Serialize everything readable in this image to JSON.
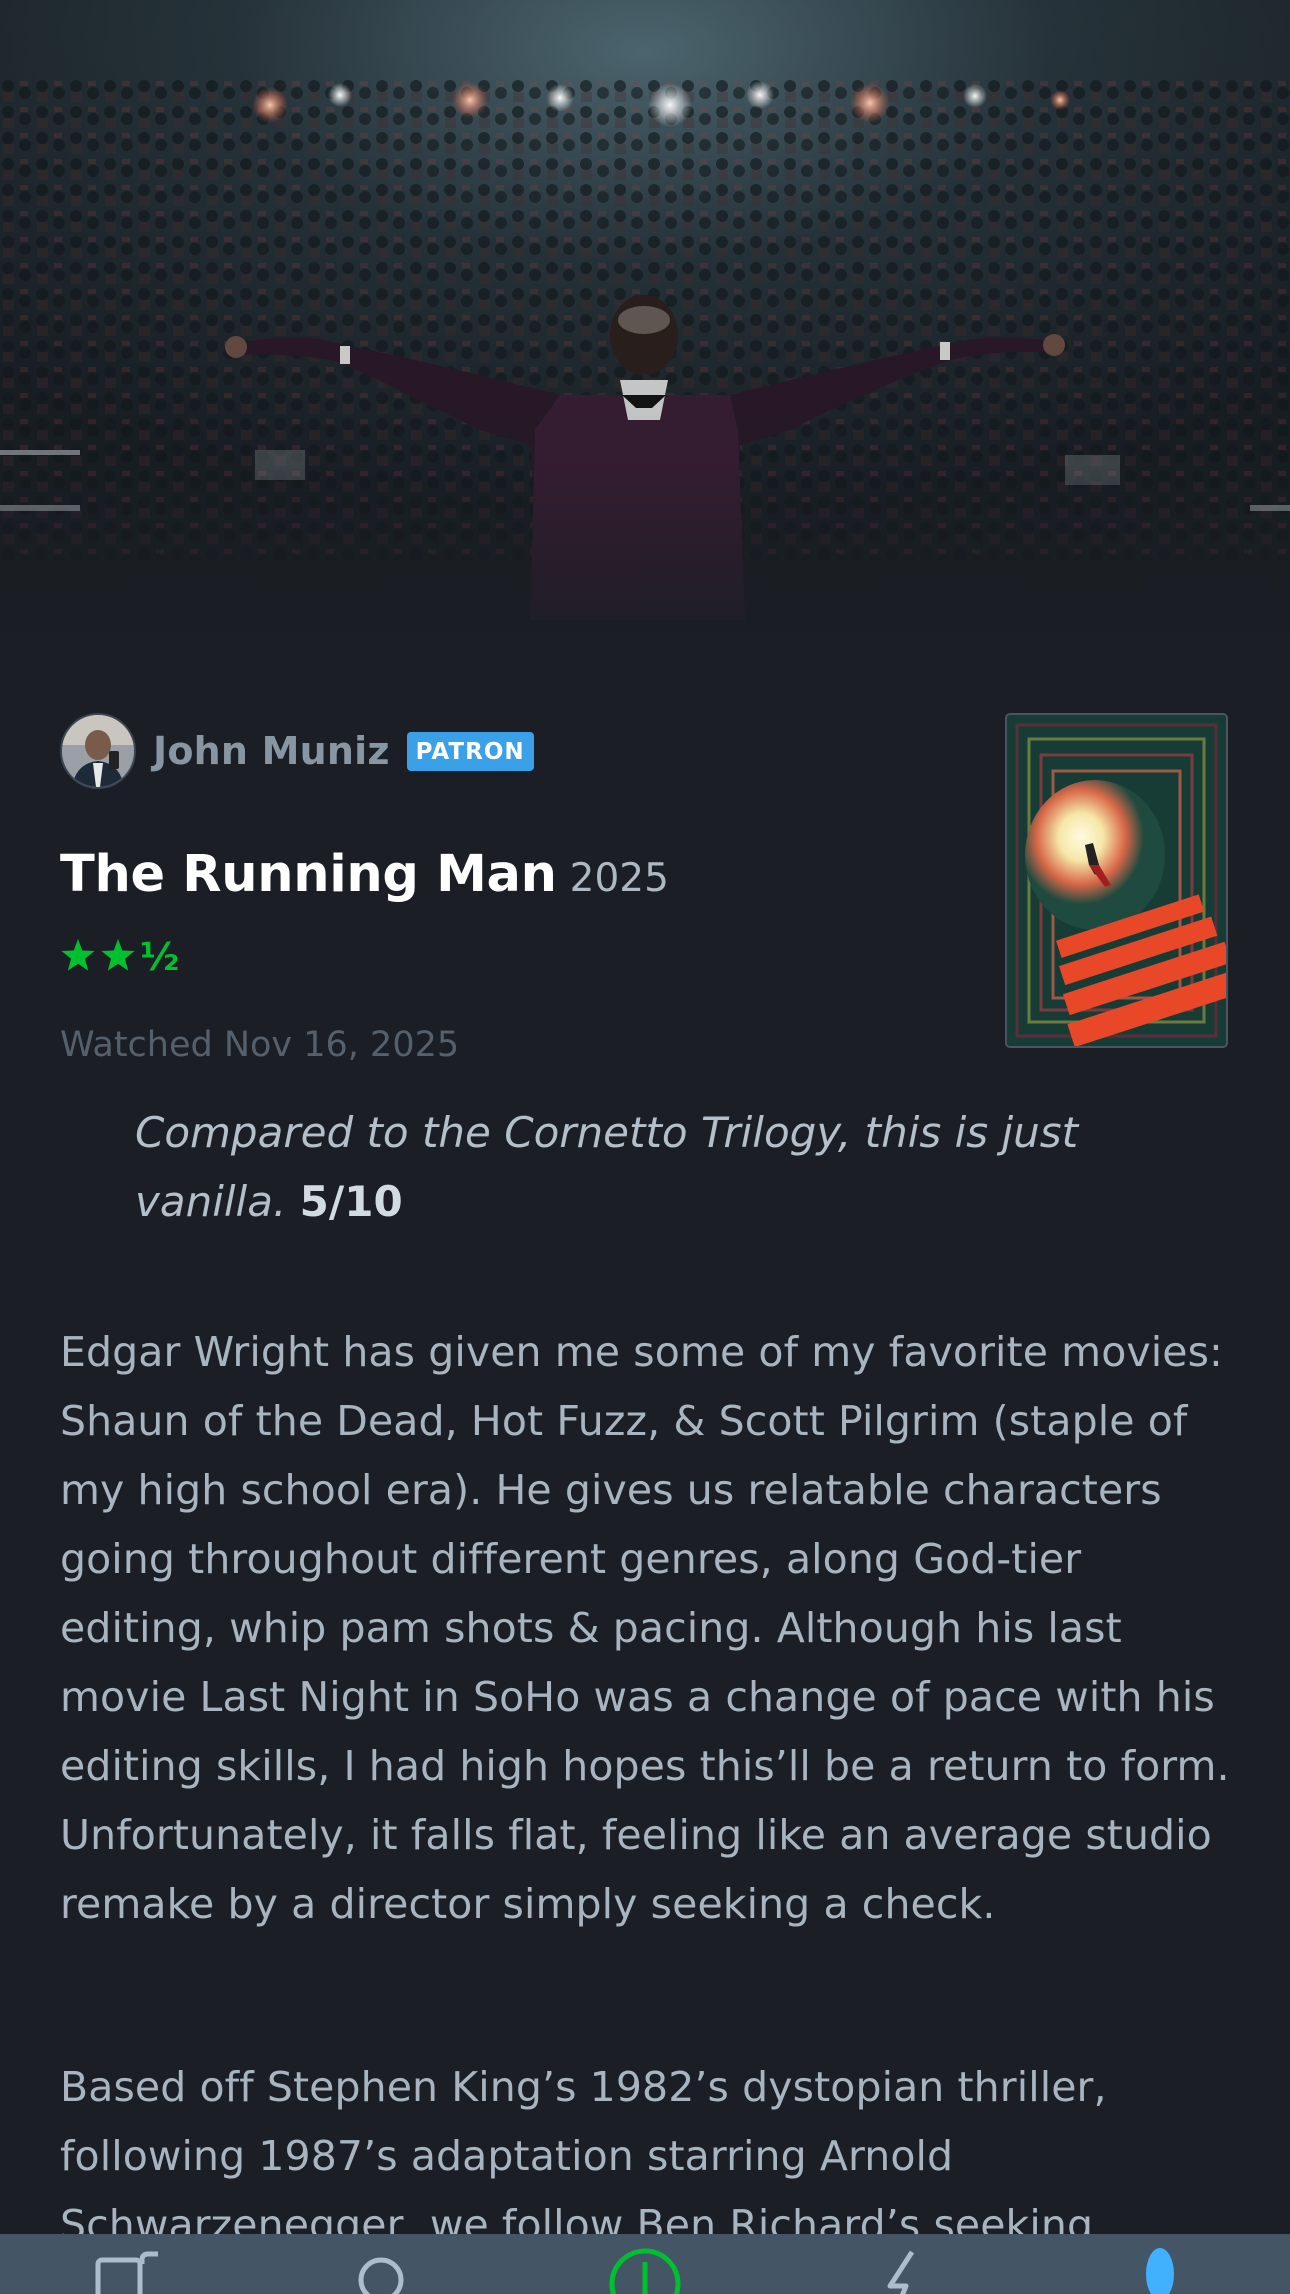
{
  "review": {
    "author": {
      "name": "John Muniz",
      "badge": "PATRON"
    },
    "film": {
      "title": "The Running Man",
      "year": "2025"
    },
    "rating": {
      "stars": 2.5,
      "max": 5,
      "half_glyph": "½"
    },
    "watched": "Watched Nov 16, 2025",
    "quote": {
      "text": "Compared to the Cornetto Trilogy, this is just vanilla.",
      "score": "5/10"
    },
    "paragraphs": [
      "Edgar Wright has given me some of my favorite movies: Shaun of the Dead, Hot Fuzz, & Scott Pilgrim (staple of my high school era). He gives us relatable characters going throughout different genres, along God-tier editing, whip pam shots & pacing. Although his last movie Last Night in SoHo was a change of pace with his editing skills, I had high hopes this’ll be a return to form. Unfortunately, it falls flat, feeling like an average studio remake by a director simply seeking a check.",
      "Based off Stephen King’s 1982’s dystopian thriller, following 1987’s adaptation starring Arnold Schwarzenegger, we follow Ben Richard’s seeking"
    ]
  },
  "tabbar": {
    "tabs": [
      {
        "icon": "films-icon"
      },
      {
        "icon": "search-icon"
      },
      {
        "icon": "add-icon"
      },
      {
        "icon": "activity-icon"
      },
      {
        "icon": "profile-icon"
      }
    ]
  },
  "colors": {
    "background": "#1b1e24",
    "star_green": "#00c030",
    "patron_blue": "#3aa0e8",
    "tabbar": "#445566"
  }
}
